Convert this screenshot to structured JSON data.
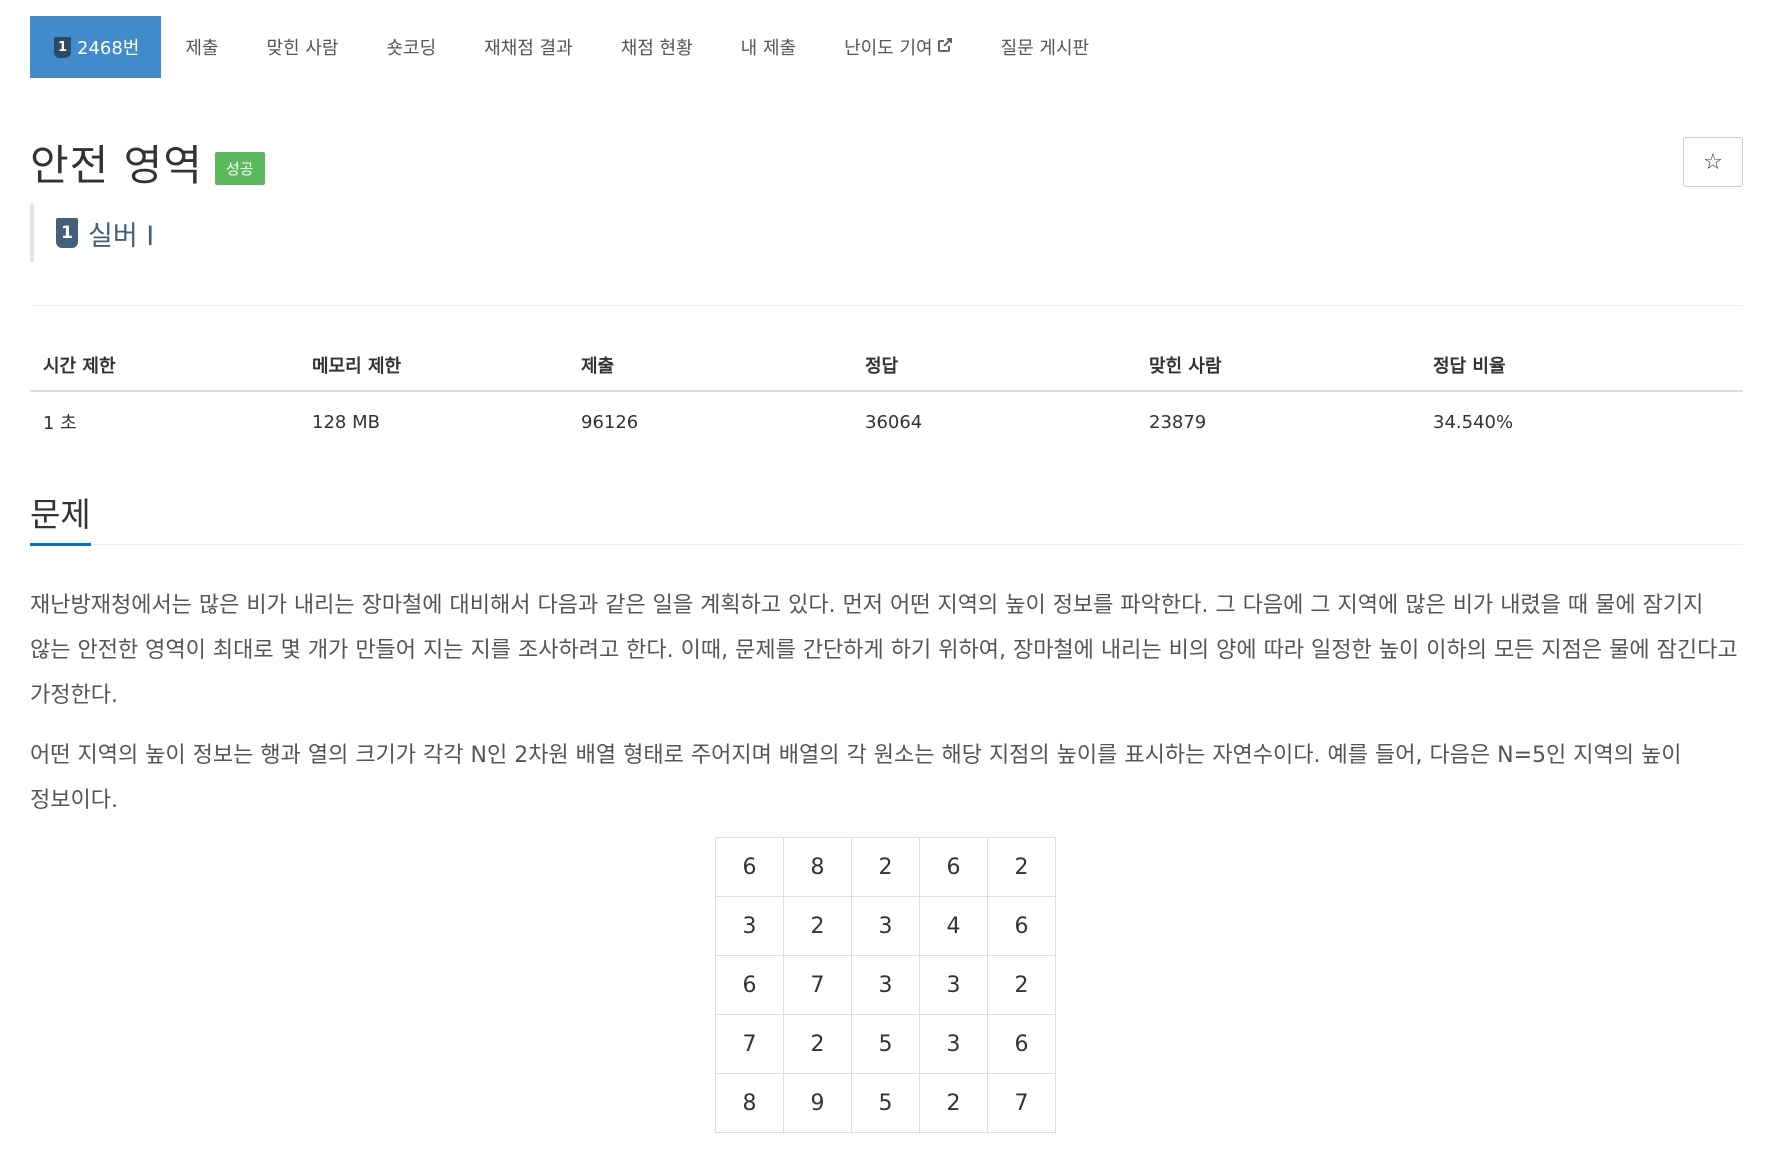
{
  "nav": {
    "tabs": [
      {
        "label": "2468번",
        "tier": "1"
      },
      {
        "label": "제출"
      },
      {
        "label": "맞힌 사람"
      },
      {
        "label": "숏코딩"
      },
      {
        "label": "재채점 결과"
      },
      {
        "label": "채점 현황"
      },
      {
        "label": "내 제출"
      },
      {
        "label": "난이도 기여",
        "external_icon": "external-link-icon"
      },
      {
        "label": "질문 게시판"
      }
    ]
  },
  "problem": {
    "title": "안전 영역",
    "status": "성공",
    "tier_number": "1",
    "tier_label": "실버 I",
    "star": "☆"
  },
  "info": {
    "headers": [
      "시간 제한",
      "메모리 제한",
      "제출",
      "정답",
      "맞힌 사람",
      "정답 비율"
    ],
    "values": [
      "1 초",
      "128 MB",
      "96126",
      "36064",
      "23879",
      "34.540%"
    ]
  },
  "section": {
    "title": "문제",
    "paragraphs": [
      "재난방재청에서는 많은 비가 내리는 장마철에 대비해서 다음과 같은 일을 계획하고 있다. 먼저 어떤 지역의 높이 정보를 파악한다. 그 다음에 그 지역에 많은 비가 내렸을 때 물에 잠기지 않는 안전한 영역이 최대로 몇 개가 만들어 지는 지를 조사하려고 한다. 이때, 문제를 간단하게 하기 위하여, 장마철에 내리는 비의 양에 따라 일정한 높이 이하의 모든 지점은 물에 잠긴다고 가정한다.",
      "어떤 지역의 높이 정보는 행과 열의 크기가 각각 N인 2차원 배열 형태로 주어지며 배열의 각 원소는 해당 지점의 높이를 표시하는 자연수이다. 예를 들어, 다음은 N=5인 지역의 높이 정보이다."
    ]
  },
  "grid": [
    [
      "6",
      "8",
      "2",
      "6",
      "2"
    ],
    [
      "3",
      "2",
      "3",
      "4",
      "6"
    ],
    [
      "6",
      "7",
      "3",
      "3",
      "2"
    ],
    [
      "7",
      "2",
      "5",
      "3",
      "6"
    ],
    [
      "8",
      "9",
      "5",
      "2",
      "7"
    ]
  ],
  "colors": {
    "active_tab": "#428bca",
    "success_label": "#5cb85c",
    "tier_silver": "#435f7a",
    "section_underline": "#0076c0"
  }
}
